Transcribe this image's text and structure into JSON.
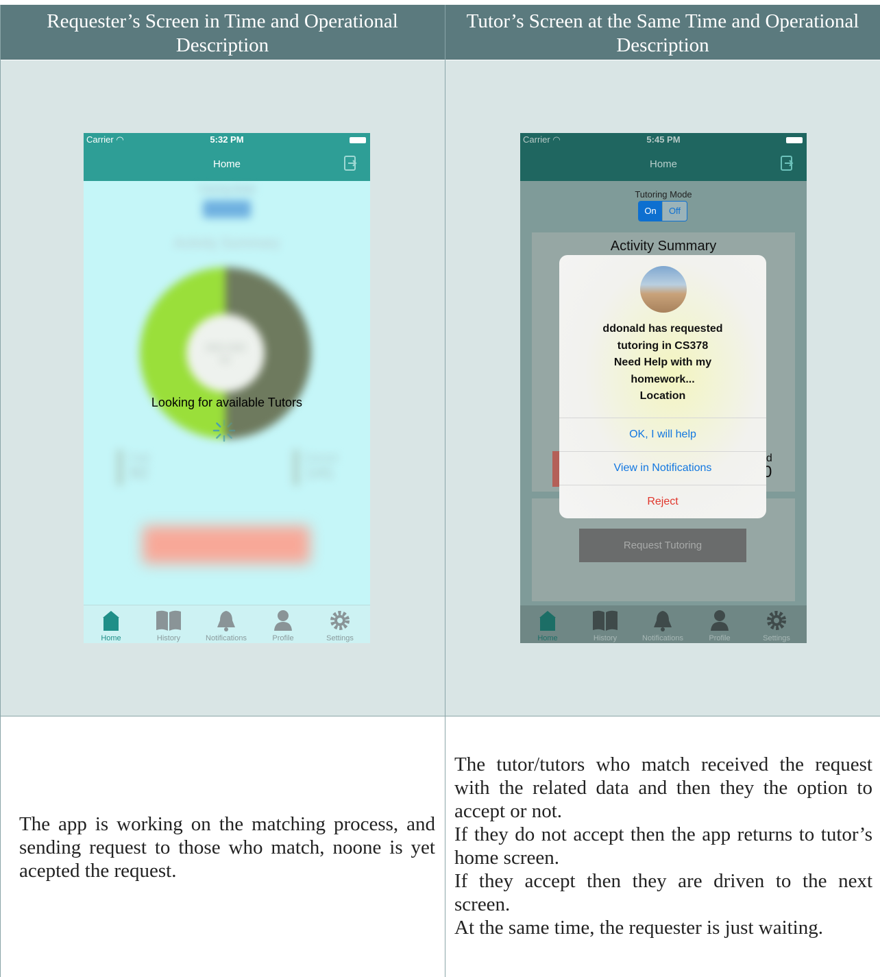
{
  "table": {
    "header_left": "Requester’s Screen in Time and Operational Description",
    "header_right": "Tutor’s Screen at the Same Time and Operational Description",
    "desc_left": "The app is working on the matching process, and sending request to those who match, noone is yet acepted the request.",
    "desc_right": [
      "The tutor/tutors who match received the request with the related data and then they the option to accept or not.",
      "If they do not accept then the app returns to tutor’s home screen.",
      "If they accept then they are driven to the next screen.",
      "At the same time, the requester is just waiting."
    ]
  },
  "requester_phone": {
    "carrier": "Carrier",
    "time": "5:32 PM",
    "nav_title": "Home",
    "status_text": "Looking for available Tutors",
    "blurred": {
      "tutoring_mode": "Tutoring Mode",
      "on": "On",
      "off": "Off",
      "activity_summary": "Activity Summary",
      "dots_total_label": "dots total",
      "dots_total_value": "61",
      "paid_label": "Paid",
      "paid_value": "82",
      "earned_label": "Earned",
      "earned_value": "141"
    }
  },
  "tutor_phone": {
    "carrier": "Carrier",
    "time": "5:45 PM",
    "nav_title": "Home",
    "tutoring_mode": "Tutoring Mode",
    "on": "On",
    "off": "Off",
    "activity_summary": "Activity Summary",
    "earned_fragment": "ed",
    "earned_value_fragment": "0",
    "request_button": "Request Tutoring",
    "alert": {
      "line1": "ddonald has requested",
      "line2": "tutoring in CS378",
      "line3": "Need Help with my",
      "line4": "homework...",
      "line5": "Location",
      "ok": "OK, I will help",
      "view": "View in Notifications",
      "reject": "Reject"
    }
  },
  "tabs": [
    "Home",
    "History",
    "Notifications",
    "Profile",
    "Settings"
  ],
  "colors": {
    "header_bg": "#5b7a7e",
    "cell_bg": "#d9e5e5",
    "app_teal": "#2e9e96",
    "ios_blue": "#1277e0",
    "ios_red": "#e0362c"
  }
}
